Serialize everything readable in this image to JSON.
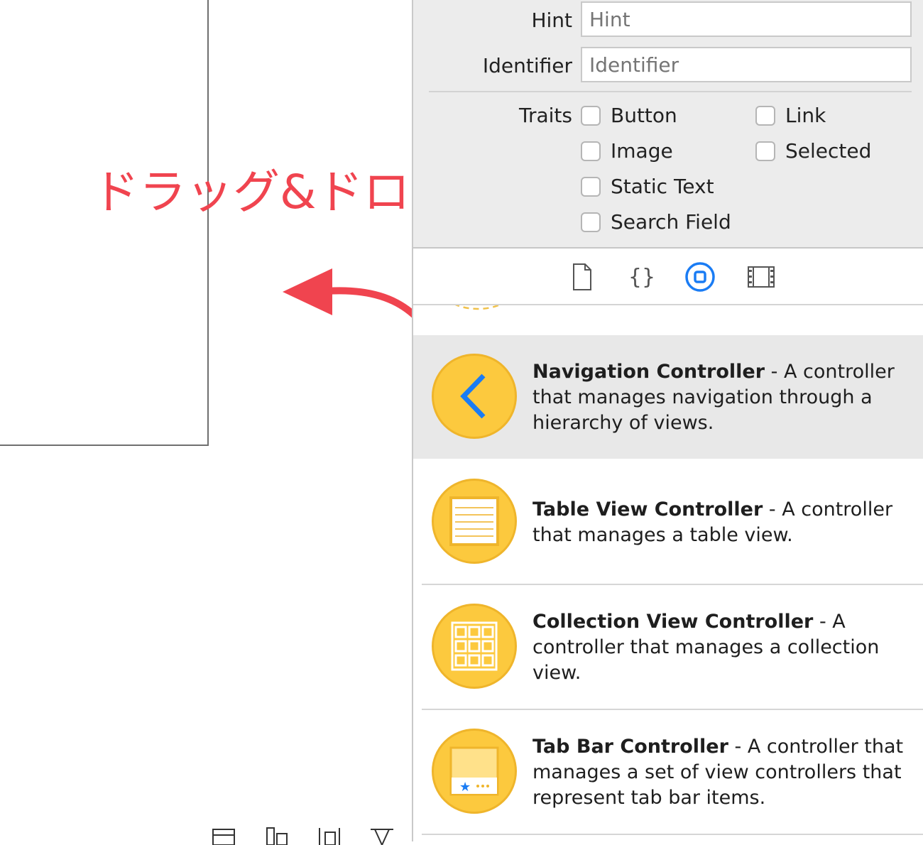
{
  "annotation": {
    "text": "ドラッグ&ドロップ",
    "color": "#f0444f"
  },
  "attributes": {
    "hint_label": "Hint",
    "hint_placeholder": "Hint",
    "identifier_label": "Identifier",
    "identifier_placeholder": "Identifier",
    "traits_label": "Traits",
    "traits": [
      {
        "label": "Button",
        "checked": false
      },
      {
        "label": "Link",
        "checked": false
      },
      {
        "label": "Image",
        "checked": false
      },
      {
        "label": "Selected",
        "checked": false
      },
      {
        "label": "Static Text",
        "checked": false
      },
      {
        "label": "Search Field",
        "checked": false
      }
    ]
  },
  "library_tabs": [
    {
      "icon": "file-template-icon",
      "selected": false
    },
    {
      "icon": "code-snippet-icon",
      "selected": false
    },
    {
      "icon": "object-library-icon",
      "selected": true
    },
    {
      "icon": "media-library-icon",
      "selected": false
    }
  ],
  "library_items": [
    {
      "title": "Navigation Controller",
      "description": " - A controller that manages navigation through a hierarchy of views.",
      "icon": "chevron-left-icon",
      "selected": true
    },
    {
      "title": "Table View Controller",
      "description": " - A controller that manages a table view.",
      "icon": "table-view-icon",
      "selected": false
    },
    {
      "title": "Collection View Controller",
      "description": " - A controller that manages a collection view.",
      "icon": "collection-grid-icon",
      "selected": false
    },
    {
      "title": "Tab Bar Controller",
      "description": " - A controller that manages a set of view controllers that represent tab bar items.",
      "icon": "tab-bar-icon",
      "selected": false
    }
  ],
  "colors": {
    "accent": "#1a7cf4",
    "library_icon": "#fcc93e",
    "selected_row": "#e8e8e8"
  }
}
